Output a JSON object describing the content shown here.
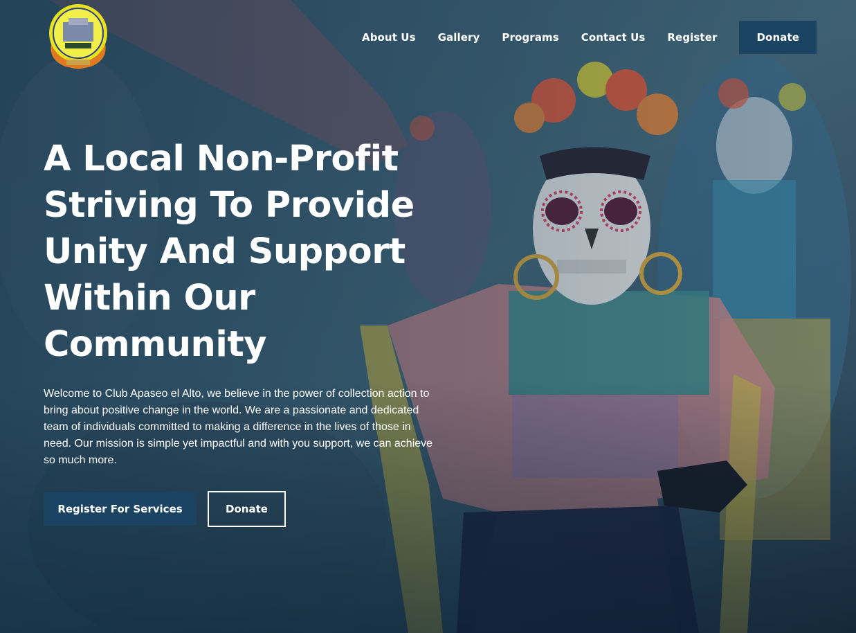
{
  "site": {
    "logo_icon": "club-apaseo-el-alto-seal"
  },
  "nav": {
    "items": [
      {
        "label": "About Us"
      },
      {
        "label": "Gallery"
      },
      {
        "label": "Programs"
      },
      {
        "label": "Contact Us"
      },
      {
        "label": "Register"
      }
    ],
    "donate_label": "Donate"
  },
  "hero": {
    "headline": "A Local Non-Profit Striving To Provide Unity And Support Within Our Community",
    "intro": "Welcome to Club Apaseo el Alto, we believe in the power of collection action to bring about positive change in the world. We are a passionate and dedicated team of individuals committed to making a difference in the lives of those in need. Our mission is simple yet impactful and with you support, we can achieve so much more.",
    "register_button": "Register For Services",
    "donate_button": "Donate"
  },
  "colors": {
    "accent": "#1b4463",
    "text": "#ffffff"
  }
}
